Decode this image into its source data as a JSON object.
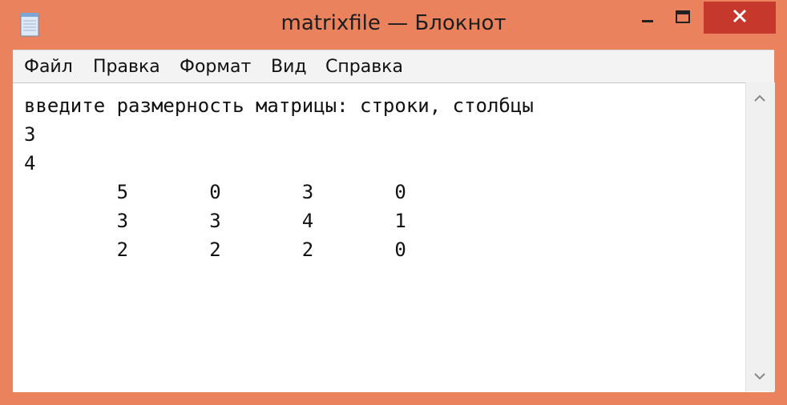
{
  "window": {
    "title": "matrixfile — Блокнот",
    "accent_color": "#e9825d",
    "close_color": "#c7382c"
  },
  "icons": {
    "app": "notepad-icon",
    "minimize": "minimize-icon",
    "maximize": "maximize-icon",
    "close": "close-icon",
    "scroll_up": "chevron-up-icon",
    "scroll_down": "chevron-down-icon"
  },
  "menu": {
    "items": [
      {
        "label": "Файл"
      },
      {
        "label": "Правка"
      },
      {
        "label": "Формат"
      },
      {
        "label": "Вид"
      },
      {
        "label": "Справка"
      }
    ]
  },
  "editor": {
    "content": "введите размерность матрицы: строки, столбцы\n3\n4\n        5       0       3       0\n        3       3       4       1\n        2       2       2       0"
  }
}
